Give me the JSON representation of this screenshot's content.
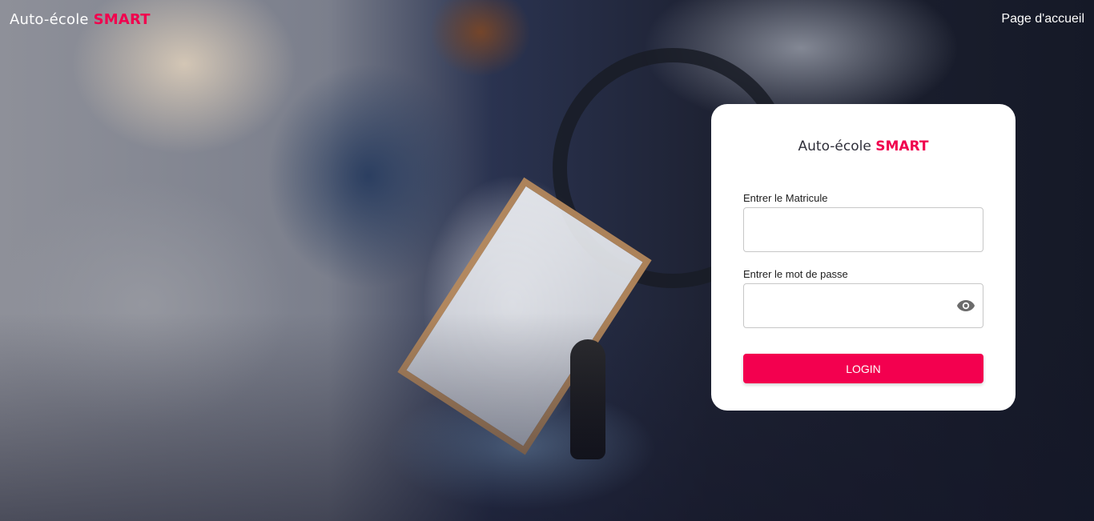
{
  "header": {
    "brand_prefix": "Auto-école",
    "brand_accent": "SMART",
    "home_link": "Page d'accueil"
  },
  "login_card": {
    "title_prefix": "Auto-école",
    "title_accent": "SMART",
    "matricule_label": "Entrer le Matricule",
    "matricule_value": "",
    "password_label": "Entrer le mot de passe",
    "password_value": "",
    "password_toggle_icon": "eye-icon",
    "login_button": "LOGIN"
  },
  "colors": {
    "accent": "#f0004e",
    "button": "#f3004f",
    "card_background": "#ffffff"
  }
}
